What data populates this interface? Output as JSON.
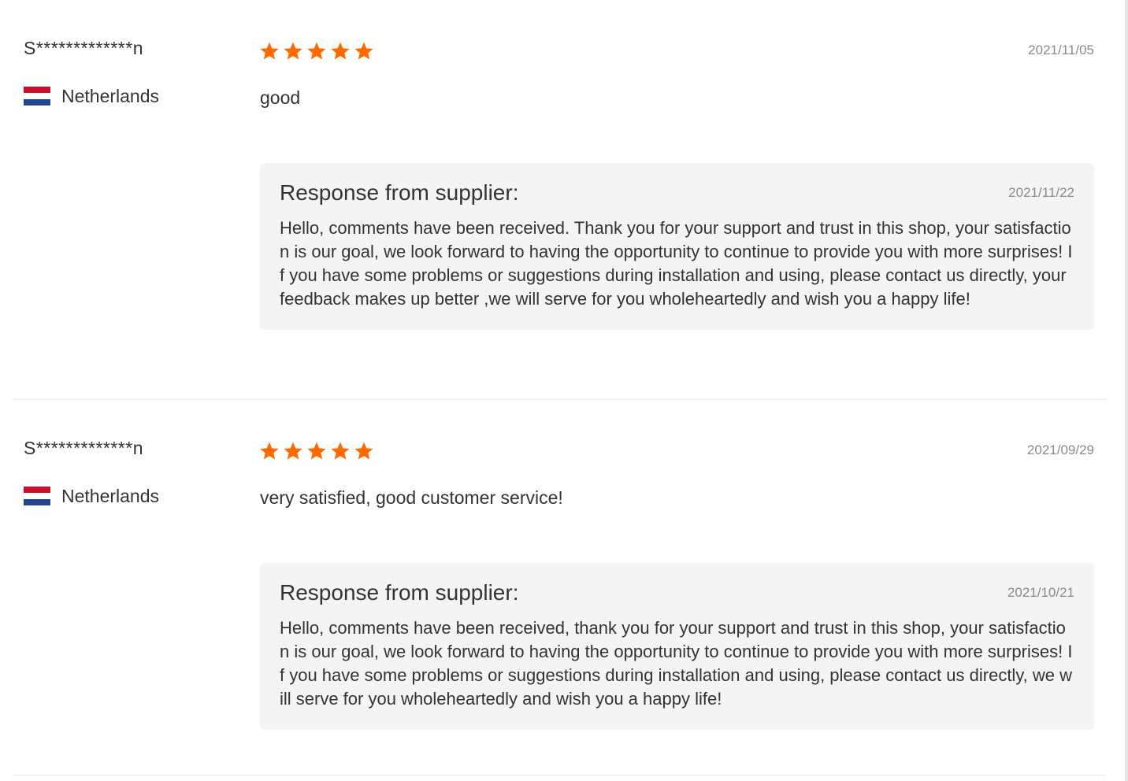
{
  "colors": {
    "star": "#ff6a00",
    "response_bg": "#f4f4f4",
    "date_text": "#8a8a8a",
    "flag_red": "#c8102e",
    "flag_blue": "#21468b"
  },
  "reviews": [
    {
      "user": "S*************n",
      "country": "Netherlands",
      "flag_icon": "netherlands-flag-icon",
      "rating": 5,
      "date": "2021/11/05",
      "text": "good",
      "response": {
        "title": "Response from supplier:",
        "date": "2021/11/22",
        "text": "Hello, comments have been received. Thank you for your support and trust in this shop, your satisfaction is our goal, we look forward to having the opportunity to continue to provide you with more surprises! If you have some problems or suggestions during installation and using, please contact us directly, your feedback makes up better ,we will serve for you wholeheartedly and wish you a happy life!"
      }
    },
    {
      "user": "S*************n",
      "country": "Netherlands",
      "flag_icon": "netherlands-flag-icon",
      "rating": 5,
      "date": "2021/09/29",
      "text": "very satisfied, good customer service!",
      "response": {
        "title": "Response from supplier:",
        "date": "2021/10/21",
        "text": "Hello, comments have been received, thank you for your support and trust in this shop, your satisfaction is our goal, we look forward to having the opportunity to continue to provide you with more surprises! If you have some problems or suggestions during installation and using, please contact us directly, we will serve for you wholeheartedly and wish you a happy life!"
      }
    }
  ]
}
